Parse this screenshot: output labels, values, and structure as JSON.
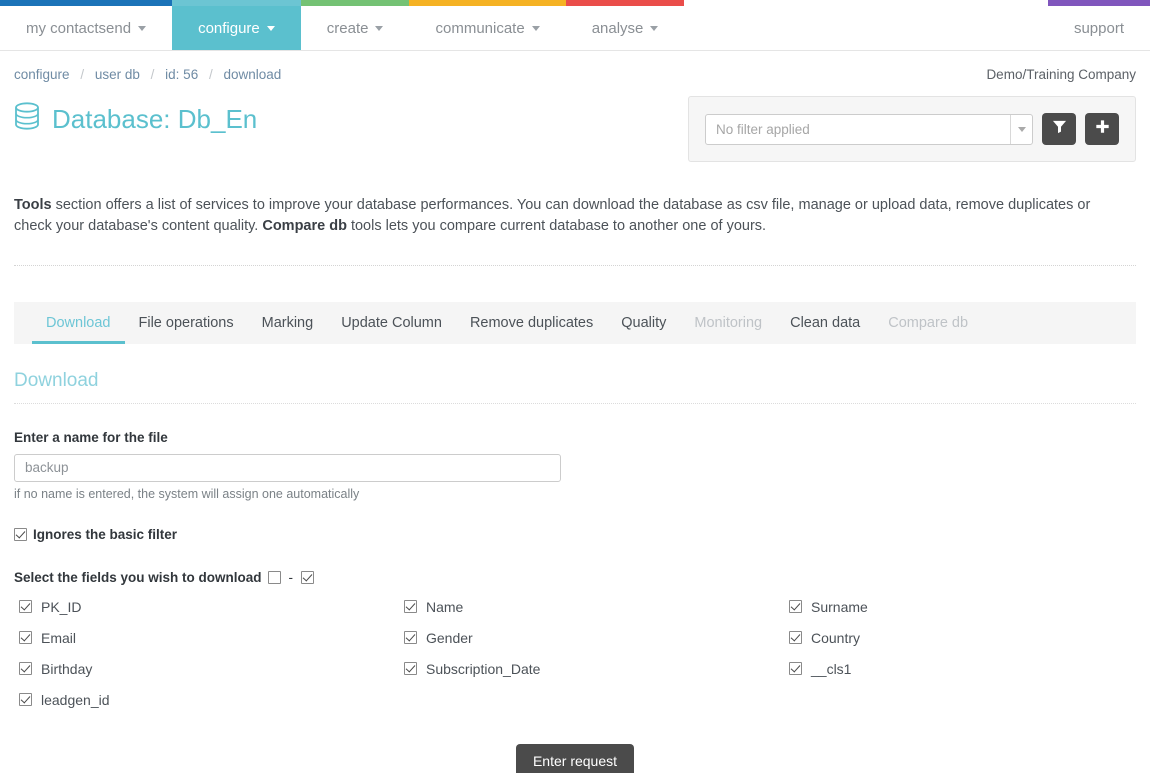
{
  "nav": {
    "items": [
      {
        "label": "my contactsend",
        "caret": true,
        "active": false,
        "color": "#1b73b8"
      },
      {
        "label": "configure",
        "caret": true,
        "active": true,
        "color": "#6cc5d3"
      },
      {
        "label": "create",
        "caret": true,
        "active": false,
        "color": "#74c274"
      },
      {
        "label": "communicate",
        "caret": true,
        "active": false,
        "color": "#f5b223"
      },
      {
        "label": "analyse",
        "caret": true,
        "active": false,
        "color": "#ea4d4a"
      },
      {
        "label": "support",
        "caret": false,
        "active": false,
        "color": "#8056bd"
      }
    ]
  },
  "breadcrumb": {
    "items": [
      "configure",
      "user db",
      "id: 56",
      "download"
    ],
    "separator": "/"
  },
  "header": {
    "company": "Demo/Training Company",
    "title": "Database: Db_En",
    "db_icon": "database-icon"
  },
  "filter_panel": {
    "select_value": "No filter applied",
    "filter_button_icon": "funnel-icon",
    "add_button_icon": "plus-icon"
  },
  "tools_text": {
    "b1": "Tools",
    "t1": " section offers a list of services to improve your database performances. You can download the database as csv file, manage or upload data, remove duplicates or check your database's content quality. ",
    "b2": "Compare db",
    "t2": " tools lets you compare current database to another one of yours."
  },
  "tabs": [
    {
      "label": "Download",
      "state": "active"
    },
    {
      "label": "File operations",
      "state": "normal"
    },
    {
      "label": "Marking",
      "state": "normal"
    },
    {
      "label": "Update Column",
      "state": "normal"
    },
    {
      "label": "Remove duplicates",
      "state": "normal"
    },
    {
      "label": "Quality",
      "state": "normal"
    },
    {
      "label": "Monitoring",
      "state": "disabled"
    },
    {
      "label": "Clean data",
      "state": "normal"
    },
    {
      "label": "Compare db",
      "state": "disabled"
    }
  ],
  "download": {
    "section_title": "Download",
    "file_name_label": "Enter a name for the file",
    "file_name_value": "backup",
    "file_name_placeholder": "backup",
    "file_name_hint": "if no name is entered, the system will assign one automatically",
    "ignore_filter_label": "Ignores the basic filter",
    "ignore_filter_checked": true,
    "select_fields_label": "Select the fields you wish to download",
    "select_none_checked": false,
    "select_all_checked": true,
    "dash": "-",
    "fields": [
      {
        "label": "PK_ID",
        "checked": true
      },
      {
        "label": "Name",
        "checked": true
      },
      {
        "label": "Surname",
        "checked": true
      },
      {
        "label": "Email",
        "checked": true
      },
      {
        "label": "Gender",
        "checked": true
      },
      {
        "label": "Country",
        "checked": true
      },
      {
        "label": "Birthday",
        "checked": true
      },
      {
        "label": "Subscription_Date",
        "checked": true
      },
      {
        "label": "__cls1",
        "checked": true
      },
      {
        "label": "leadgen_id",
        "checked": true
      }
    ],
    "submit_label": "Enter request"
  },
  "colors": {
    "accent": "#5bc0ce",
    "dark_button": "#4b4b4b",
    "tabbar_bg": "#f5f5f5",
    "panel_bg": "#f6f6f6"
  }
}
